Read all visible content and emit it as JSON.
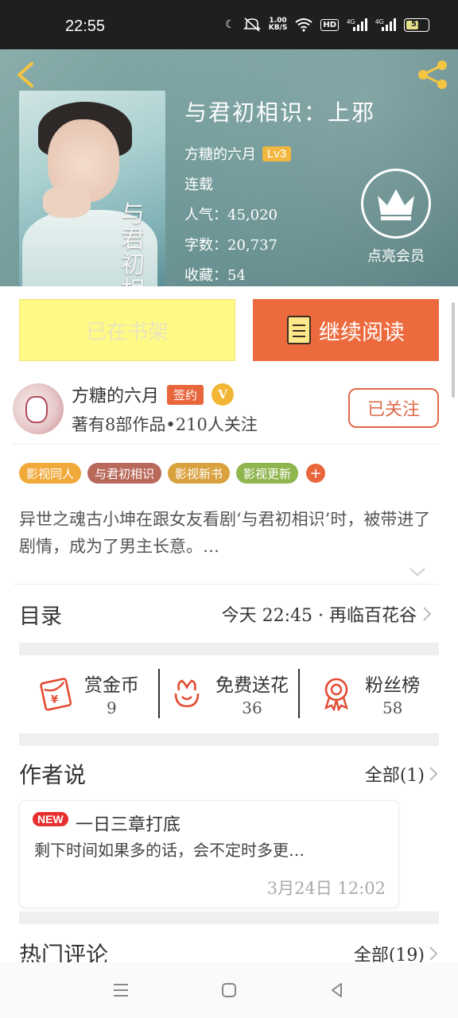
{
  "status_bar": {
    "time": "22:55",
    "net_speed_value": "1.00",
    "net_speed_unit": "KB/S",
    "hd_label": "HD",
    "sim1": "4G",
    "sim2": "4G",
    "battery": "51"
  },
  "book": {
    "title": "与君初相识：上邪",
    "author": "方糖的六月",
    "level": "Lv3",
    "status": "连载",
    "popularity": "人气：45,020",
    "words": "字数：20,737",
    "favorites": "收藏：54",
    "cover_text": "与君初相识"
  },
  "vip": {
    "label": "点亮会员"
  },
  "buttons": {
    "shelf": "已在书架",
    "read": "继续阅读",
    "follow": "已关注"
  },
  "author_card": {
    "name": "方糖的六月",
    "sign_badge": "签约",
    "v_badge": "V",
    "stats": "著有8部作品•210人关注"
  },
  "tags": [
    {
      "label": "影视同人",
      "color": "#f1a93a"
    },
    {
      "label": "与君初相识",
      "color": "#b8695a"
    },
    {
      "label": "影视新书",
      "color": "#d9a23f"
    },
    {
      "label": "影视更新",
      "color": "#8fb54e"
    }
  ],
  "tags_more": "+",
  "synopsis": "异世之魂古小坤在跟女友看剧‘与君初相识’时，被带进了剧情，成为了男主长意。…",
  "toc": {
    "label": "目录",
    "latest": "今天 22:45 · 再临百花谷"
  },
  "actions": [
    {
      "label": "赏金币",
      "count": "9"
    },
    {
      "label": "免费送花",
      "count": "36"
    },
    {
      "label": "粉丝榜",
      "count": "58"
    }
  ],
  "author_says": {
    "title": "作者说",
    "more": "全部(1)",
    "new_badge": "NEW",
    "note_title": "一日三章打底",
    "note_body": "剩下时间如果多的话，会不定时多更…",
    "note_date": "3月24日  12:02"
  },
  "hot_comments": {
    "title": "热门评论",
    "more": "全部(19)"
  },
  "colors": {
    "accent": "#ec6a3e",
    "shelf_bg": "#fff986",
    "hero_bg": "#6f9898"
  }
}
